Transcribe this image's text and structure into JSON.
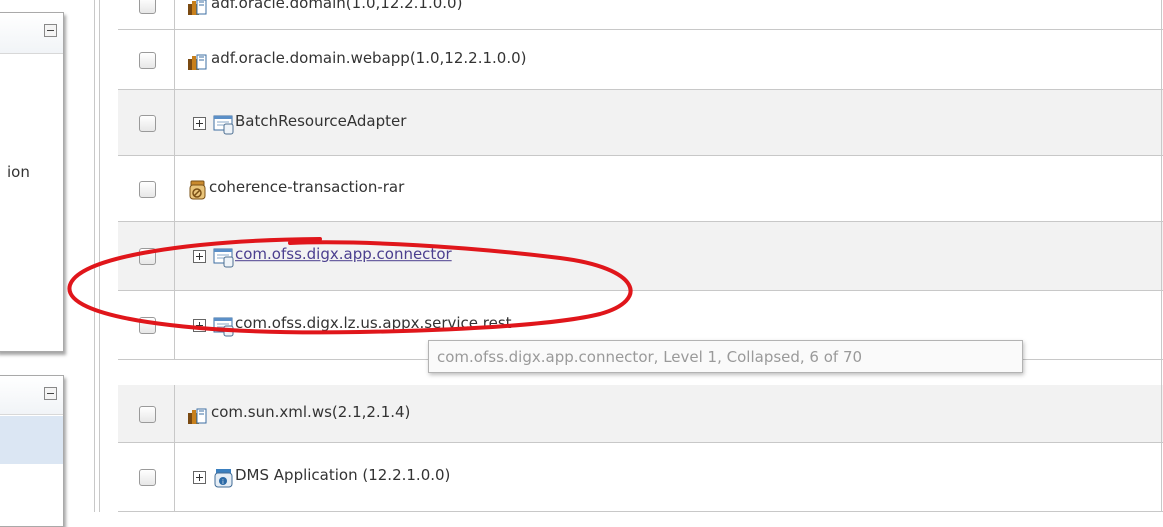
{
  "left_panel": {
    "partial_text": "ion"
  },
  "tree_rows": [
    {
      "label": "adf.oracle.domain(1.0,12.2.1.0.0)",
      "icon": "library-icon",
      "expandable": false,
      "link": false
    },
    {
      "label": "adf.oracle.domain.webapp(1.0,12.2.1.0.0)",
      "icon": "library-icon",
      "expandable": false,
      "link": false
    },
    {
      "label": "BatchResourceAdapter",
      "icon": "resource-adapter-icon",
      "expandable": true,
      "link": false
    },
    {
      "label": "coherence-transaction-rar",
      "icon": "connector-jar-icon",
      "expandable": false,
      "link": false
    },
    {
      "label": "com.ofss.digx.app.connector",
      "icon": "resource-adapter-icon",
      "expandable": true,
      "link": true
    },
    {
      "label": "com.ofss.digx.lz.us.appx.service.rest",
      "icon": "resource-adapter-icon",
      "expandable": true,
      "link": false
    },
    {
      "label": "com.sun.xml.ws(2.1,2.1.4)",
      "icon": "library-icon",
      "expandable": false,
      "link": false
    },
    {
      "label": "DMS Application (12.2.1.0.0)",
      "icon": "application-icon",
      "expandable": true,
      "link": false
    }
  ],
  "tooltip": {
    "text": "com.ofss.digx.app.connector, Level 1, Collapsed, 6 of 70"
  },
  "colors": {
    "annotation": "#e0161b",
    "link": "#4b3f8f",
    "row_alt": "#f2f2f2",
    "border": "#c8c8c8"
  }
}
